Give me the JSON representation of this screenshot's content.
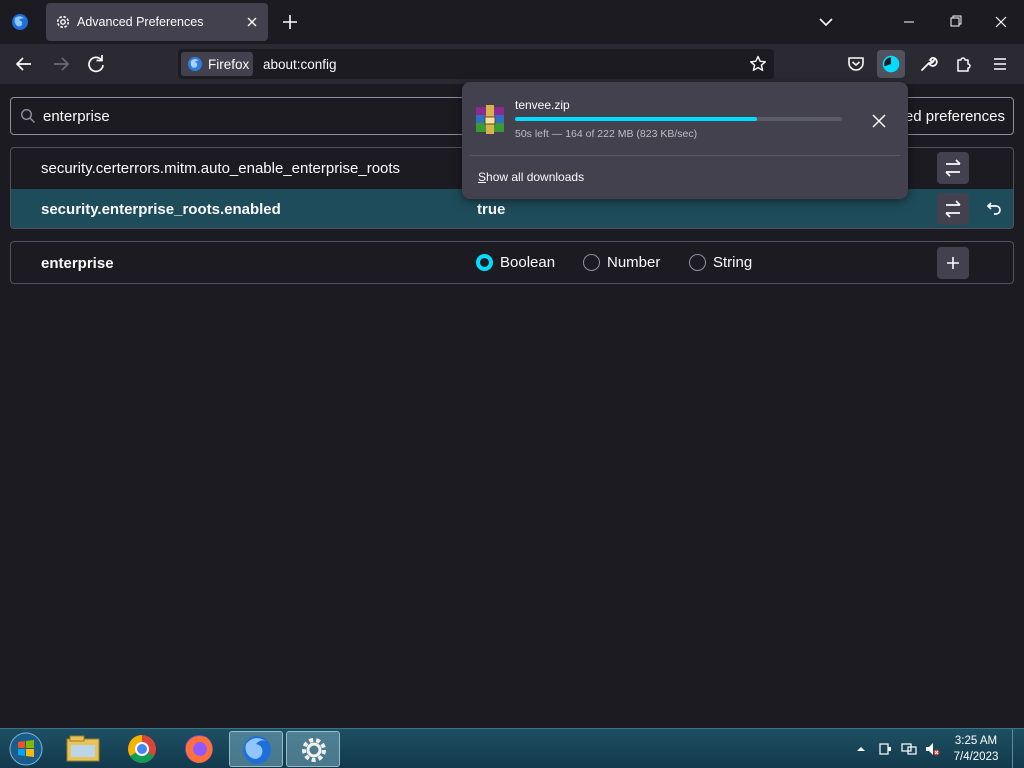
{
  "tab": {
    "title": "Advanced Preferences"
  },
  "navbar": {
    "identity_label": "Firefox",
    "url": "about:config"
  },
  "search": {
    "value": "enterprise",
    "show_modified_label": "Show only modified preferences",
    "show_modified_visible": "fied preferences"
  },
  "prefs": [
    {
      "name": "security.certerrors.mitm.auto_enable_enterprise_roots",
      "value": ""
    },
    {
      "name": "security.enterprise_roots.enabled",
      "value": "true"
    }
  ],
  "add_pref": {
    "name": "enterprise",
    "types": [
      "Boolean",
      "Number",
      "String"
    ],
    "selected_type": "Boolean"
  },
  "download": {
    "filename": "tenvee.zip",
    "status": "50s left — 164 of 222 MB (823 KB/sec)",
    "progress": 0.739,
    "show_all": "Show all downloads",
    "show_all_accesskey": "S",
    "show_all_rest": "how all downloads"
  },
  "taskbar": {
    "time": "3:25 AM",
    "date": "7/4/2023"
  },
  "colors": {
    "accent": "#00ddff",
    "highlight_row": "#1f4c5a",
    "background": "#1c1b22"
  }
}
